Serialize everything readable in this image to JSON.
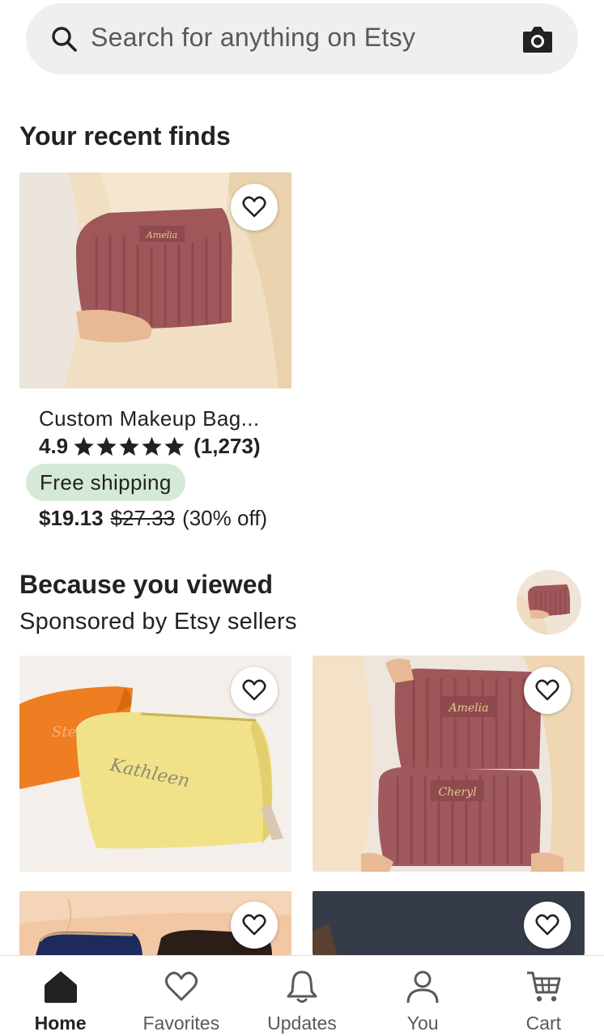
{
  "search": {
    "placeholder": "Search for anything on Etsy"
  },
  "recent": {
    "title": "Your recent finds",
    "item": {
      "title": "Custom Makeup Bag...",
      "rating": "4.9",
      "reviews": "(1,273)",
      "badge": "Free shipping",
      "price": "$19.13",
      "original_price": "$27.33",
      "discount": "(30% off)",
      "image_text": "Amelia"
    }
  },
  "because": {
    "title": "Because you viewed",
    "subtitle": "Sponsored by Etsy sellers",
    "items": [
      {
        "image_text": "Kathleen"
      },
      {
        "image_text": "Amelia",
        "image_text_2": "Cheryl"
      },
      {
        "image_text": ""
      },
      {
        "image_text": ""
      }
    ]
  },
  "nav": {
    "items": [
      {
        "label": "Home",
        "icon": "home-icon",
        "active": true
      },
      {
        "label": "Favorites",
        "icon": "heart-icon"
      },
      {
        "label": "Updates",
        "icon": "bell-icon"
      },
      {
        "label": "You",
        "icon": "person-icon"
      },
      {
        "label": "Cart",
        "icon": "cart-icon"
      }
    ]
  },
  "colors": {
    "accent_green": "#d4e9d7",
    "rose": "#a3595c",
    "search_bg": "#efefef"
  }
}
